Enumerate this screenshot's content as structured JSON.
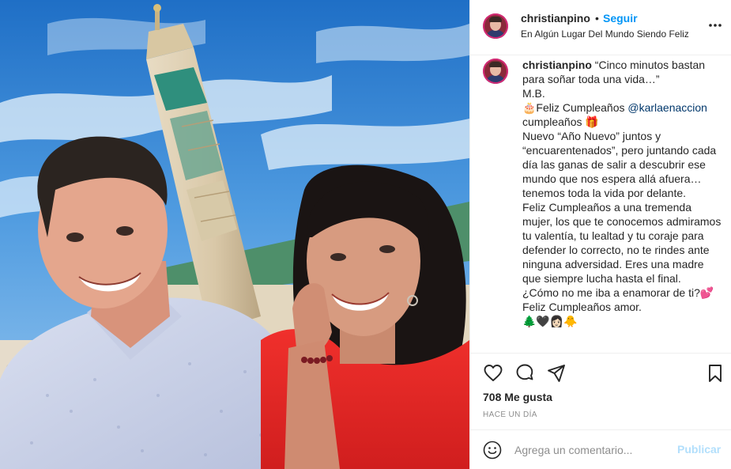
{
  "header": {
    "username": "christianpino",
    "separator": "•",
    "follow_label": "Seguir",
    "location": "En Algún Lugar Del Mundo Siendo Feliz",
    "more_icon": "more-horizontal-icon"
  },
  "caption": {
    "username": "christianpino",
    "lines": {
      "l1": "“Cinco minutos bastan para soñar toda una vida…”",
      "l2": "M.B.",
      "l3_pre": "🎂Feliz Cumpleaños ",
      "l3_mention": "@karlaenaccion",
      "l3_post": " cumpleaños 🎁",
      "l4": "Nuevo “Año Nuevo” juntos y “encuarentenados”, pero juntando cada día las ganas de salir a descubrir ese mundo que nos espera allá afuera…tenemos toda la vida por delante.",
      "l5": "Feliz Cumpleaños a una tremenda mujer, los que te conocemos admiramos tu valentía, tu lealtad y tu coraje para defender lo correcto, no te rindes ante ninguna adversidad. Eres una madre que siempre lucha hasta el final.",
      "l6": "¿Cómo no me iba a enamorar de ti?💕",
      "l7": "Feliz Cumpleaños amor.",
      "l8": "🌲🖤👩🏻🐥"
    }
  },
  "actions": {
    "like_icon": "heart-icon",
    "comment_icon": "comment-icon",
    "share_icon": "paper-plane-icon",
    "save_icon": "bookmark-icon",
    "likes_text": "708 Me gusta",
    "date_text": "HACE UN DÍA"
  },
  "comment_bar": {
    "emoji_icon": "smiley-icon",
    "placeholder": "Agrega un comentario...",
    "post_label": "Publicar"
  },
  "colors": {
    "link_blue": "#0095f6",
    "mention_blue": "#00376b",
    "muted": "#8e8e8e",
    "post_disabled": "#b2dffc"
  }
}
